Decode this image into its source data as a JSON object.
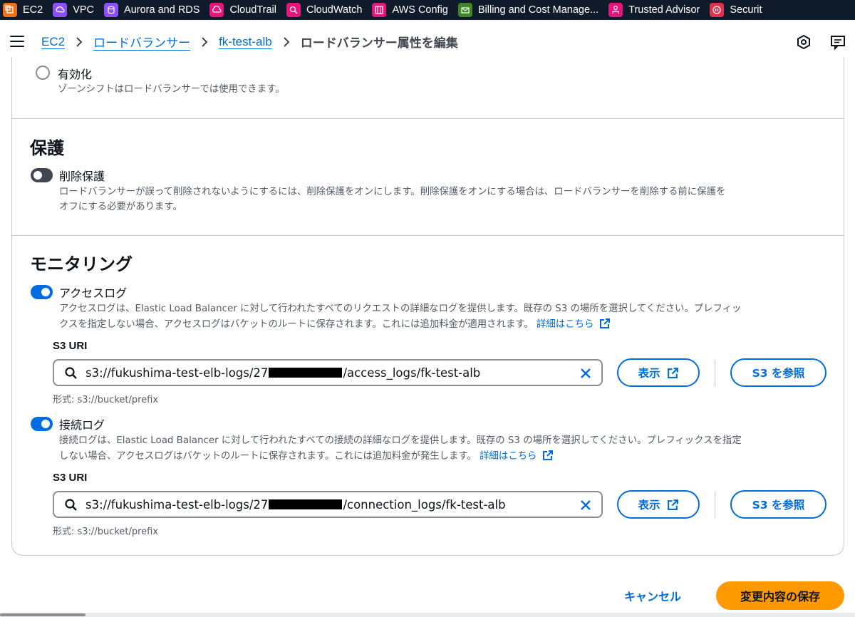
{
  "favorites": [
    {
      "label": "EC2",
      "icon": "ec2-icon",
      "color": "#e8731a"
    },
    {
      "label": "VPC",
      "icon": "vpc-icon",
      "color": "#8c4fff"
    },
    {
      "label": "Aurora and RDS",
      "icon": "rds-icon",
      "color": "#8c4fff"
    },
    {
      "label": "CloudTrail",
      "icon": "cloudtrail-icon",
      "color": "#e7157b"
    },
    {
      "label": "CloudWatch",
      "icon": "cloudwatch-icon",
      "color": "#e7157b"
    },
    {
      "label": "AWS Config",
      "icon": "config-icon",
      "color": "#e7157b"
    },
    {
      "label": "Billing and Cost Manage...",
      "icon": "billing-icon",
      "color": "#3f8624"
    },
    {
      "label": "Trusted Advisor",
      "icon": "trusted-advisor-icon",
      "color": "#e7157b"
    },
    {
      "label": "Securit",
      "icon": "security-icon",
      "color": "#dd344c"
    }
  ],
  "breadcrumb": {
    "items": [
      "EC2",
      "ロードバランサー",
      "fk-test-alb"
    ],
    "current": "ロードバランサー属性を編集"
  },
  "zonal_shift": {
    "option_label": "有効化",
    "description": "ゾーンシフトはロードバランサーでは使用できます。"
  },
  "protection": {
    "title": "保護",
    "toggle_label": "削除保護",
    "toggle_on": false,
    "description_line1": "ロードバランサーが誤って削除されないようにするには、削除保護をオンにします。削除保護をオンにする場合は、ロードバランサーを削除する前に保護を",
    "description_line2": "オフにする必要があります。"
  },
  "monitoring": {
    "title": "モニタリング",
    "access_logs": {
      "toggle_label": "アクセスログ",
      "toggle_on": true,
      "description_line1": "アクセスログは、Elastic Load Balancer に対して行われたすべてのリクエストの詳細なログを提供します。既存の S3 の場所を選択してください。プレフィッ",
      "description_line2": "クスを指定しない場合、アクセスログはバケットのルートに保存されます。これには追加料金が適用されます。",
      "learn_more": "詳細はこちら",
      "field_label": "S3 URI",
      "value_prefix": "s3://fukushima-test-elb-logs/27",
      "value_suffix": "/access_logs/fk-test-alb",
      "hint": "形式: s3://bucket/prefix",
      "view_button": "表示",
      "browse_button": "S3 を参照"
    },
    "connection_logs": {
      "toggle_label": "接続ログ",
      "toggle_on": true,
      "description_line1": "接続ログは、Elastic Load Balancer に対して行われたすべての接続の詳細なログを提供します。既存の S3 の場所を選択してください。プレフィックスを指定",
      "description_line2": "しない場合、アクセスログはバケットのルートに保存されます。これには追加料金が発生します。",
      "learn_more": "詳細はこちら",
      "field_label": "S3 URI",
      "value_prefix": "s3://fukushima-test-elb-logs/27",
      "value_suffix": "/connection_logs/fk-test-alb",
      "hint": "形式: s3://bucket/prefix",
      "view_button": "表示",
      "browse_button": "S3 を参照"
    }
  },
  "footer": {
    "cancel": "キャンセル",
    "save": "変更内容の保存"
  },
  "colors": {
    "link": "#006ce0",
    "primary_button": "#ff9900",
    "toggle_on": "#006ce0",
    "toggle_off": "#424650",
    "favbar_bg": "#0f1b2a"
  }
}
